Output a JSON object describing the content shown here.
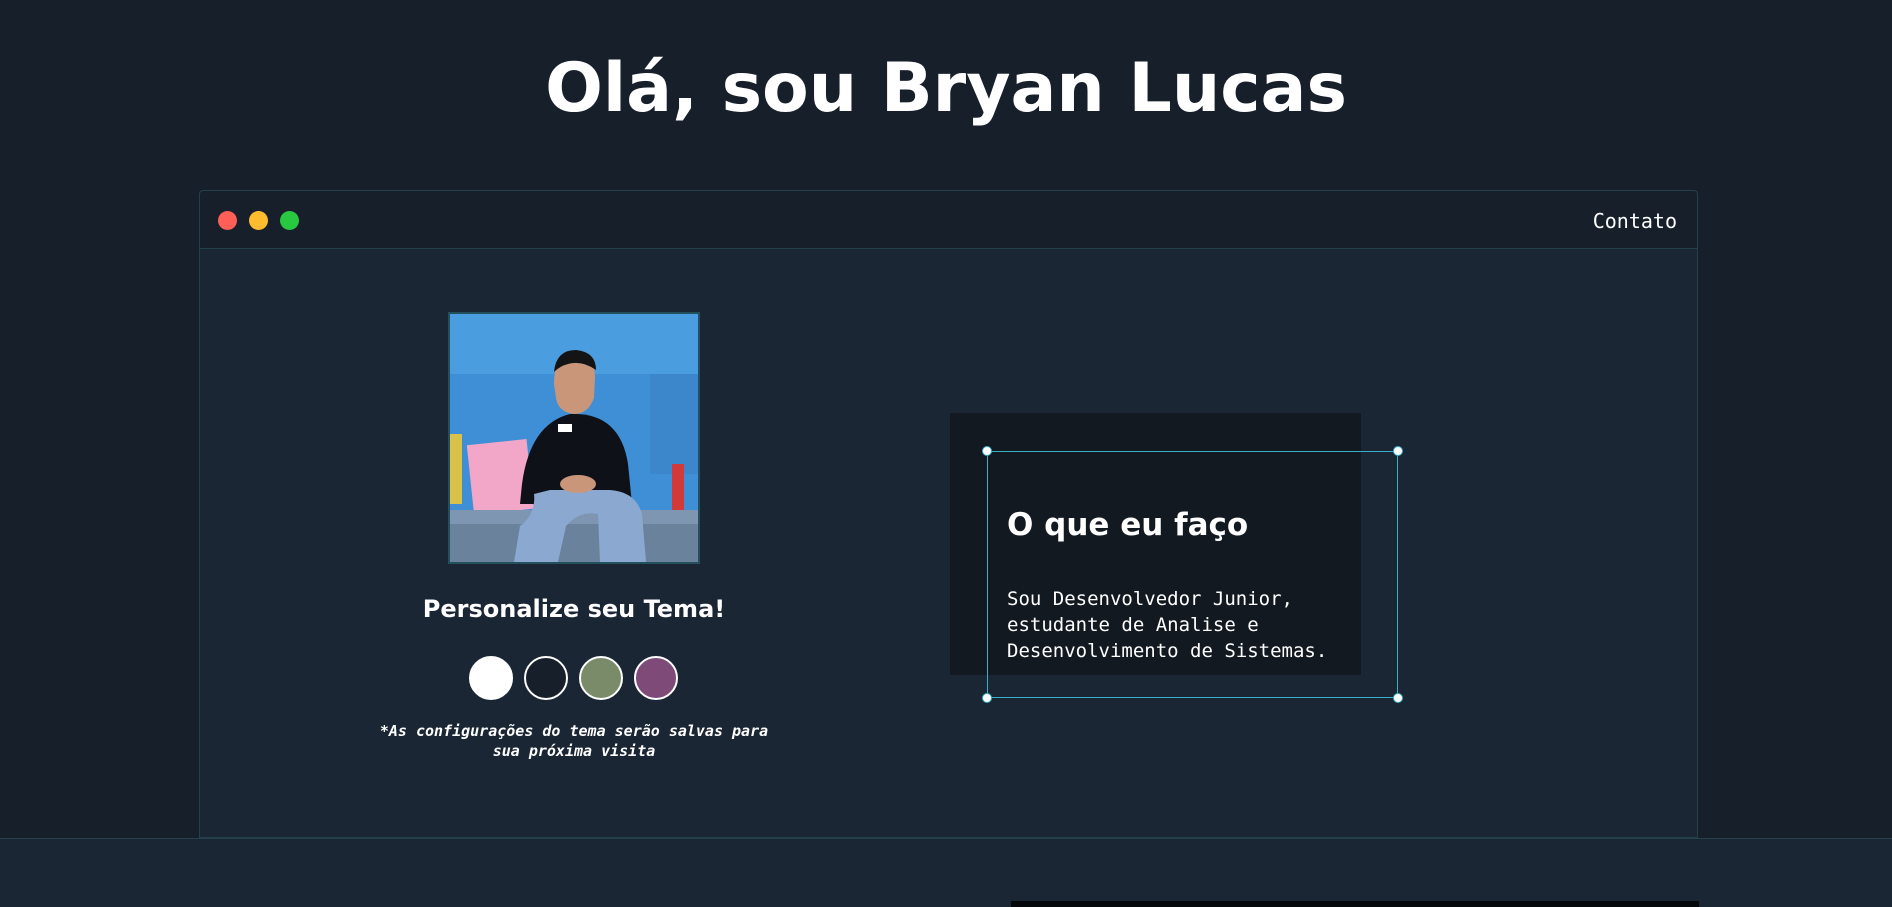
{
  "hero": {
    "title": "Olá, sou Bryan Lucas"
  },
  "window": {
    "controls": [
      {
        "name": "close",
        "color": "#ff5f57"
      },
      {
        "name": "minimize",
        "color": "#febc2e"
      },
      {
        "name": "maximize",
        "color": "#28c840"
      }
    ],
    "nav": {
      "contact_label": "Contato"
    }
  },
  "profile": {
    "photo_icon": "profile-photo"
  },
  "theme": {
    "title": "Personalize seu Tema!",
    "swatches": [
      {
        "name": "light",
        "color": "#ffffff"
      },
      {
        "name": "dark",
        "color": "#171f2a"
      },
      {
        "name": "green",
        "color": "#7a8b69"
      },
      {
        "name": "purple",
        "color": "#7e4a78"
      }
    ],
    "note": "*As configurações do tema serão salvas para sua próxima visita"
  },
  "about": {
    "title": "O que eu faço",
    "text": "Sou Desenvolvedor Junior, estudante de Analise e Desenvolvimento de Sistemas."
  },
  "colors": {
    "page_background": "#171f2a",
    "window_background": "#1b2634",
    "accent": "#3ab0c8"
  }
}
